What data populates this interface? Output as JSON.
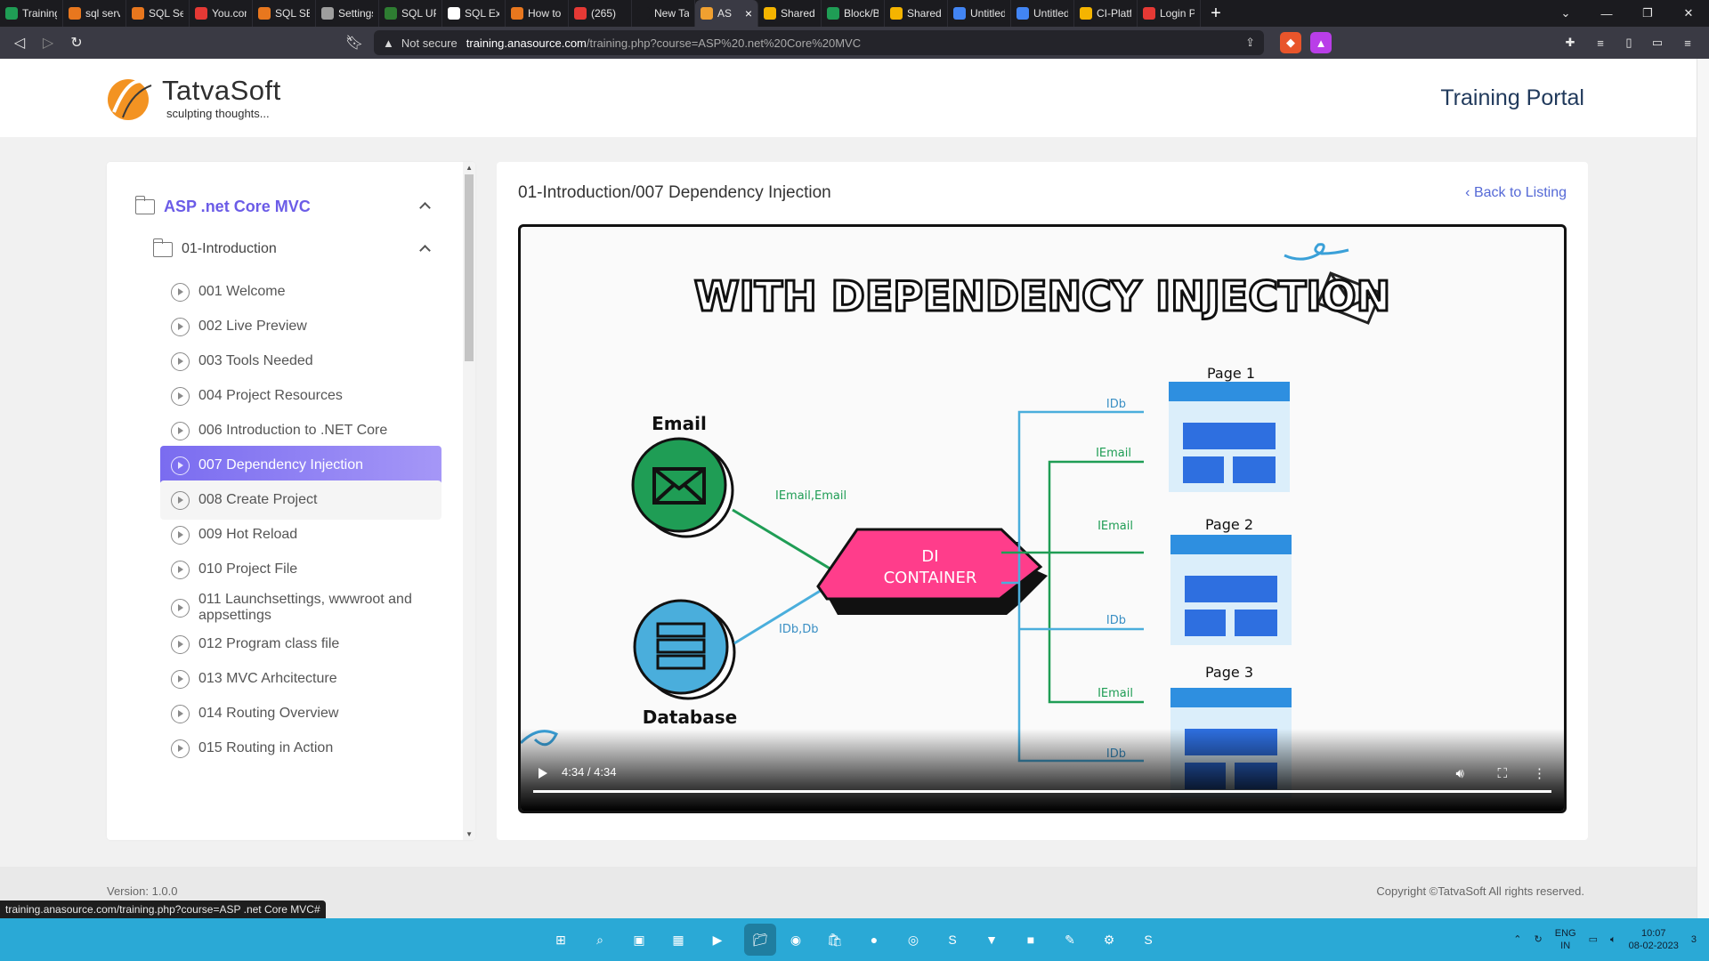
{
  "browser": {
    "tabs": [
      {
        "title": "Training P",
        "color": "#1f9d55"
      },
      {
        "title": "sql server",
        "color": "#e8771e"
      },
      {
        "title": "SQL Serve",
        "color": "#e8771e"
      },
      {
        "title": "You.com",
        "color": "#e53935"
      },
      {
        "title": "SQL SERV",
        "color": "#e8771e"
      },
      {
        "title": "Settings",
        "color": "#9e9e9e"
      },
      {
        "title": "SQL UPD.",
        "color": "#2e7d32"
      },
      {
        "title": "SQL Exerc",
        "color": "#ffffff"
      },
      {
        "title": "How to u",
        "color": "#e8771e"
      },
      {
        "title": "(265)",
        "color": "#e53935"
      },
      {
        "title": "New Tab",
        "color": "#1b1b1f"
      },
      {
        "title": "AS",
        "color": "#f0a030",
        "active": true,
        "close": "×"
      },
      {
        "title": "Shared w",
        "color": "#f4b400"
      },
      {
        "title": "Block/Bla",
        "color": "#1f9d55"
      },
      {
        "title": "Shared w",
        "color": "#f4b400"
      },
      {
        "title": "Untitled",
        "color": "#4285f4"
      },
      {
        "title": "Untitled",
        "color": "#4285f4"
      },
      {
        "title": "CI-Platfo",
        "color": "#f4b400"
      },
      {
        "title": "Login Pa",
        "color": "#e53935"
      }
    ],
    "new_tab": "+",
    "url_warning": "Not secure",
    "url_host": "training.anasource.com",
    "url_path": "/training.php?course=ASP%20.net%20Core%20MVC"
  },
  "header": {
    "logo_name": "TatvaSoft",
    "logo_tagline": "sculpting thoughts...",
    "portal_title": "Training Portal"
  },
  "sidebar": {
    "course_title": "ASP .net Core MVC",
    "section_title": "01-Introduction",
    "lessons": [
      {
        "label": "001 Welcome"
      },
      {
        "label": "002 Live Preview"
      },
      {
        "label": "003 Tools Needed"
      },
      {
        "label": "004 Project Resources"
      },
      {
        "label": "006 Introduction to .NET Core"
      },
      {
        "label": "007 Dependency Injection",
        "active": true
      },
      {
        "label": "008 Create Project",
        "hover": true
      },
      {
        "label": "009 Hot Reload"
      },
      {
        "label": "010 Project File"
      },
      {
        "label": "011 Launchsettings, wwwroot and appsettings"
      },
      {
        "label": "012 Program class file"
      },
      {
        "label": "013 MVC Arhcitecture"
      },
      {
        "label": "014 Routing Overview"
      },
      {
        "label": "015 Routing in Action"
      }
    ]
  },
  "main": {
    "lesson_heading": "01-Introduction/007 Dependency Injection",
    "back_link": "‹ Back to Listing",
    "video": {
      "slide_title": "WITH DEPENDENCY INJECTION",
      "email_label": "Email",
      "database_label": "Database",
      "container_label_1": "DI",
      "container_label_2": "CONTAINER",
      "email_flow_label": "IEmail,Email",
      "db_flow_label": "IDb,Db",
      "pages": [
        "Page 1",
        "Page 2",
        "Page 3"
      ],
      "idb": "IDb",
      "iemail": "IEmail",
      "time": "4:34 / 4:34",
      "progress": 1.0,
      "accent_pink": "#ff3d8b",
      "accent_green": "#1f9d55",
      "accent_blue": "#4aaedc"
    }
  },
  "footer": {
    "version": "Version: 1.0.0",
    "copyright": "Copyright ©TatvaSoft All rights reserved."
  },
  "status_url": "training.anasource.com/training.php?course=ASP .net Core MVC#",
  "taskbar": {
    "lang_1": "ENG",
    "lang_2": "IN",
    "time": "10:07",
    "date": "08-02-2023",
    "notification_count": "3"
  }
}
